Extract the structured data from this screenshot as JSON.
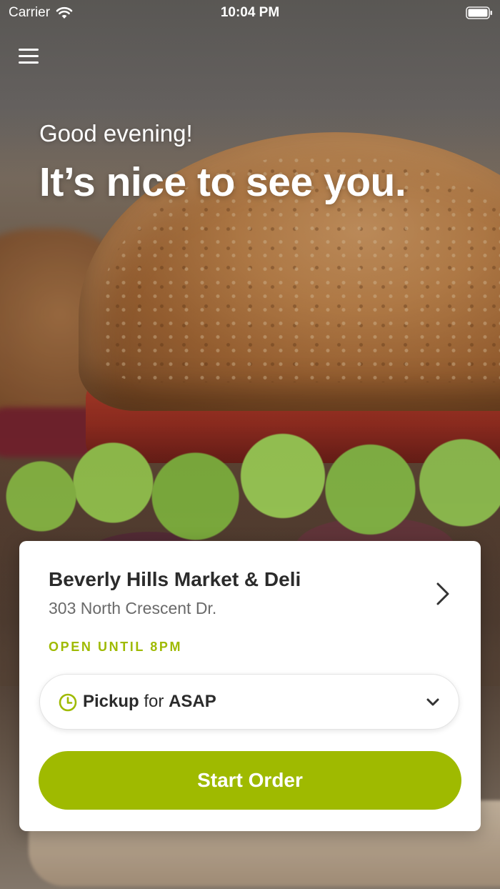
{
  "status_bar": {
    "carrier": "Carrier",
    "time": "10:04 PM"
  },
  "hero": {
    "greeting": "Good evening!",
    "headline": "It’s nice to see you."
  },
  "store_card": {
    "name": "Beverly Hills Market & Deli",
    "address": "303 North Crescent Dr.",
    "hours": "OPEN UNTIL 8PM",
    "order_mode": {
      "mode": "Pickup",
      "connector": "for",
      "time": "ASAP"
    },
    "cta_label": "Start Order"
  },
  "colors": {
    "accent": "#9fba00",
    "card_background": "#ffffff",
    "primary_text": "#2b2b2b",
    "secondary_text": "#6a6a6a"
  },
  "icons": {
    "menu": "menu-icon",
    "wifi": "wifi-icon",
    "battery": "battery-icon",
    "chevron_right": "chevron-right-icon",
    "clock": "clock-icon",
    "chevron_down": "chevron-down-icon"
  }
}
